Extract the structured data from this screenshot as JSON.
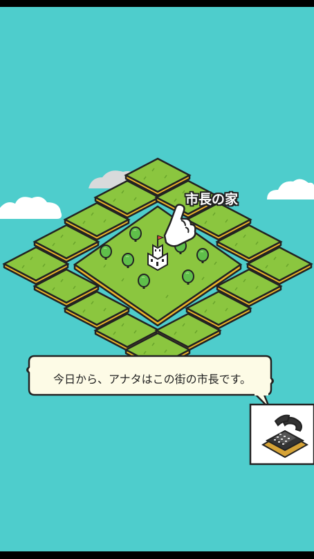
{
  "map": {
    "building_label": "市長の家"
  },
  "dialog": {
    "message": "今日から、アナタはこの街の市長です。"
  },
  "icons": {
    "pointer": "pointing-hand-icon",
    "phone": "telephone-icon",
    "building": "mayor-house-icon"
  },
  "colors": {
    "sky": "#4ecdcc",
    "grass": "#8bc63f",
    "tile_edge": "#f0b52a",
    "outline": "#222222",
    "dialog_bg": "#fdfbe6"
  }
}
